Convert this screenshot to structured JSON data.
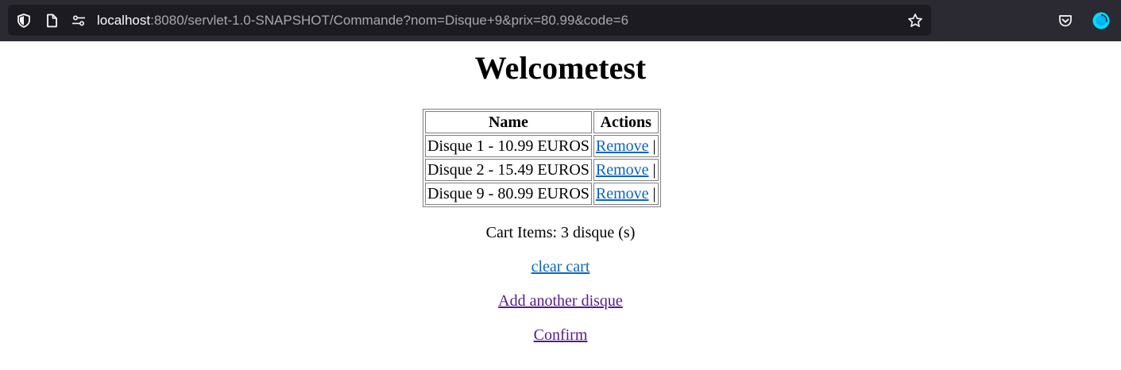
{
  "browser": {
    "url_host": "localhost",
    "url_rest": ":8080/servlet-1.0-SNAPSHOT/Commande?nom=Disque+9&prix=80.99&code=6"
  },
  "page": {
    "title": "Welcometest",
    "table": {
      "headers": [
        "Name",
        "Actions"
      ],
      "rows": [
        {
          "name": "Disque 1 - 10.99 EUROS",
          "action": "Remove",
          "sep": "|"
        },
        {
          "name": "Disque 2 - 15.49 EUROS",
          "action": "Remove",
          "sep": "|"
        },
        {
          "name": "Disque 9 - 80.99 EUROS",
          "action": "Remove",
          "sep": "|"
        }
      ]
    },
    "cart_items": "Cart Items: 3 disque (s)",
    "clear_cart": "clear cart",
    "add_another": "Add another disque",
    "confirm": "Confirm"
  },
  "colors": {
    "toolbar_bg": "#2b2a33",
    "urlbar_bg": "#1c1b22",
    "link": "#0b64c4",
    "visited_link": "#551a8b"
  },
  "icons": [
    "shield-icon",
    "page-icon",
    "permissions-icon",
    "bookmark-star-icon",
    "pocket-icon",
    "account-avatar-icon"
  ]
}
